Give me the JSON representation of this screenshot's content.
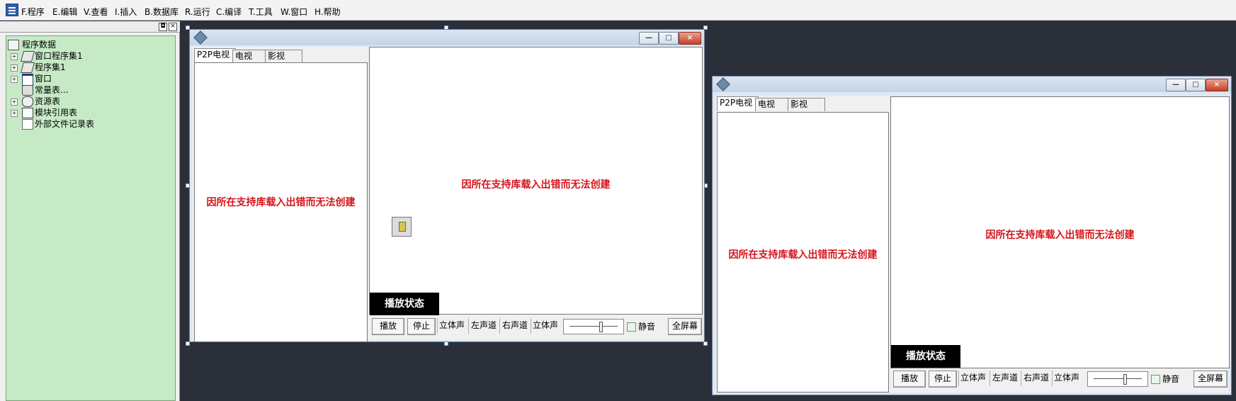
{
  "menu": {
    "items": [
      "F.程序",
      "E.编辑",
      "V.查看",
      "I.插入",
      "B.数据库",
      "R.运行",
      "C.编译",
      "T.工具",
      "W.窗口",
      "H.帮助"
    ]
  },
  "panel_buttons": [
    "◘",
    "×"
  ],
  "tree": {
    "root": "程序数据",
    "items": [
      {
        "label": "窗口程序集1",
        "icon": "window-assembly-icon",
        "expandable": true
      },
      {
        "label": "程序集1",
        "icon": "assembly-icon",
        "expandable": true
      },
      {
        "label": "窗口",
        "icon": "window-icon",
        "expandable": true
      },
      {
        "label": "常量表...",
        "icon": "constant-table-icon",
        "expandable": false
      },
      {
        "label": "资源表",
        "icon": "resource-table-icon",
        "expandable": true
      },
      {
        "label": "模块引用表",
        "icon": "module-reference-icon",
        "expandable": true
      },
      {
        "label": "外部文件记录表",
        "icon": "external-file-icon",
        "expandable": false
      }
    ]
  },
  "window_buttons": {
    "minimize": "—",
    "maximize": "□",
    "close": "×"
  },
  "design_window": {
    "tabs": [
      "P2P电视",
      "电视",
      "影视"
    ],
    "left_error": "因所在支持库载入出错而无法创建",
    "right_error": "因所在支持库载入出错而无法创建",
    "status": "播放状态",
    "controls": {
      "play": "播放",
      "stop": "停止",
      "stereo1": "立体声",
      "left": "左声道",
      "right": "右声道",
      "stereo2": "立体声",
      "mute": "静音",
      "fullscreen": "全屏幕"
    },
    "volume_level": 0.65
  },
  "preview_window": {
    "tabs": [
      "P2P电视",
      "电视",
      "影视"
    ],
    "left_error": "因所在支持库载入出错而无法创建",
    "right_error": "因所在支持库载入出错而无法创建",
    "status": "播放状态",
    "controls": {
      "play": "播放",
      "stop": "停止",
      "stereo1": "立体声",
      "left": "左声道",
      "right": "右声道",
      "stereo2": "立体声",
      "mute": "静音",
      "fullscreen": "全屏幕"
    },
    "volume_level": 0.65
  },
  "colors": {
    "tree_bg": "#c6eac6",
    "error_text": "#d4141b",
    "status_bg": "#000000"
  }
}
